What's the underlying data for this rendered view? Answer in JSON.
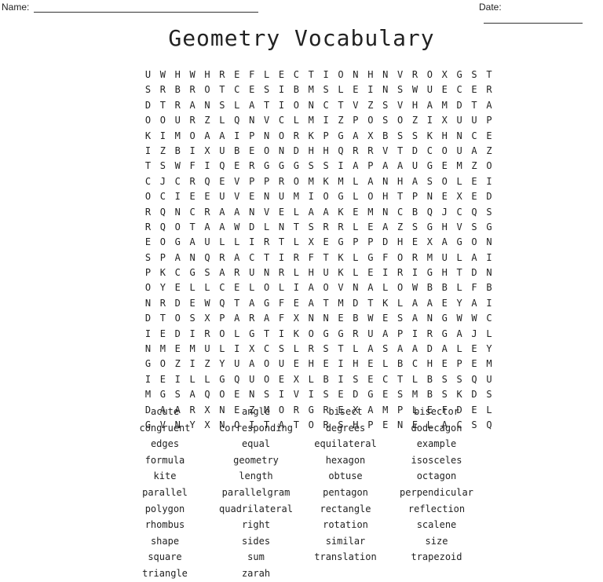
{
  "header": {
    "name_label": "Name:",
    "date_label": "Date:"
  },
  "title": "Geometry Vocabulary",
  "grid": [
    "UWHWHREFLECTIONHNVROXGST",
    "SRBROTCESIBMSLEINSWUECER",
    "DTRANSLATIONCTVZSVHAMDTA",
    "OOURZLQNVCLMIZPOSOZIXUUP",
    "KIMOAAIPNORKPGAXBSSKHNCE",
    "IZBIXUBEONDHHQRRVTDCOUAZ",
    "TSWFIQERGGGSSIAPAAUGEMZO",
    "CJCRQEVPPROMKMLANHASOLEI",
    "OCIEEUVENUMIOGLOHTPNEXED",
    "RQNCRAANVELAAKEMNCBQJCQS",
    "RQOTAAWDLNTSRRLEAZSGHVSG",
    "EOGAULLIRTLXEGPPDHEXAGON",
    "SPANQRACTIRFTKLGFORMULAI",
    "PKCGSARUNRLHUKLEIRIGHTDN",
    "OYELLCELOLIAOVNALOWBBLFB",
    "NRDEWQTAGFEATMDTKLAAEYAI",
    "DTOSXPARAFXNNEBWESANGWWC",
    "IEDIROLGTIKOGGRUAPIRGAJL",
    "NMEMULIXCSLRSTLASAADALEY",
    "GOZIZYUAOUEHEIHELBCHEPEM",
    "IEILLGQUOEXLBISECTLBSSQU",
    "MGSAQOENSIVISEDGESMBSKDS",
    "DAARXNEZMORGREXAMPLEFDEL",
    "GVNYXNOITATORSHPENELACSQ"
  ],
  "words": [
    "acute",
    "angle",
    "bisect",
    "bisector",
    "congruent",
    "corresponding",
    "degrees",
    "dodecagon",
    "edges",
    "equal",
    "equilateral",
    "example",
    "formula",
    "geometry",
    "hexagon",
    "isosceles",
    "kite",
    "length",
    "obtuse",
    "octagon",
    "parallel",
    "parallelgram",
    "pentagon",
    "perpendicular",
    "polygon",
    "quadrilateral",
    "rectangle",
    "reflection",
    "rhombus",
    "right",
    "rotation",
    "scalene",
    "shape",
    "sides",
    "similar",
    "size",
    "square",
    "sum",
    "translation",
    "trapezoid",
    "triangle",
    "zarah"
  ]
}
